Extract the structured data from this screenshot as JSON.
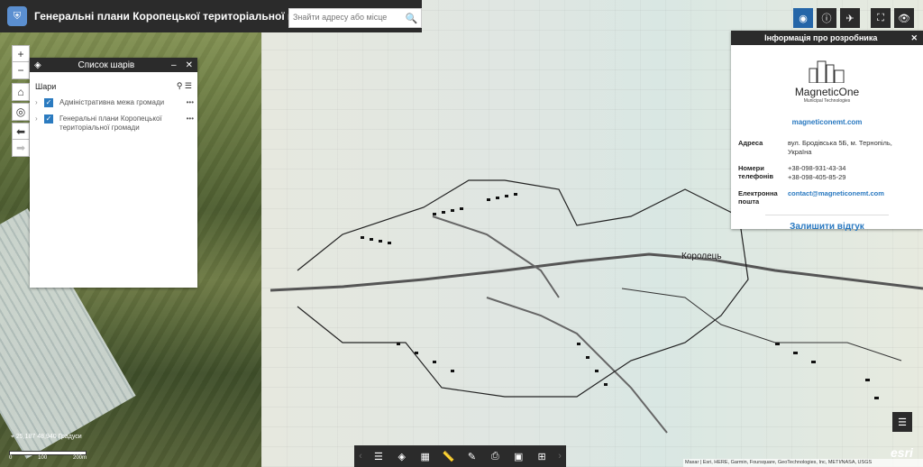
{
  "header": {
    "title": "Генеральні плани Коропецької територіальної громади",
    "search_placeholder": "Знайти адресу або місце"
  },
  "map": {
    "place_label": "Королець",
    "coordinates": "25,187 48,940 Градуси",
    "scale_labels": [
      "0",
      "100",
      "200m"
    ],
    "attribution": "Maxar | Esri, HERE, Garmin, Foursquare, GeoTechnologies, Inc, METI/NASA, USGS",
    "esri": "esri"
  },
  "layers_panel": {
    "title": "Список шарів",
    "section": "Шари",
    "items": [
      {
        "label": "Адміністративна межа громади",
        "checked": true
      },
      {
        "label": "Генеральні плани Коропецької територіальної громади",
        "checked": true
      }
    ]
  },
  "info_panel": {
    "title": "Інформація про розробника",
    "brand_name": "MagneticOne",
    "brand_tagline": "Municipal Technologies",
    "website": "magneticonemt.com",
    "rows": [
      {
        "key": "Адреса",
        "value": "вул. Бродівська 5Б, м. Тернопіль, Україна"
      },
      {
        "key": "Номери телефонів",
        "value": "+38-098-931-43-34"
      },
      {
        "key": "",
        "value": "+38-098-405-85-29"
      },
      {
        "key": "Електронна пошта",
        "value": "contact@magneticonemt.com"
      }
    ],
    "feedback": "Залишити відгук"
  },
  "colors": {
    "header_bg": "#2b2b2b",
    "accent": "#2566a8",
    "link": "#2878c0"
  }
}
